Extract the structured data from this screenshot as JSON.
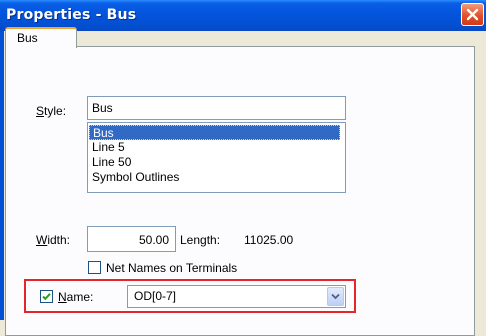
{
  "window": {
    "title": "Properties - Bus"
  },
  "tabs": [
    {
      "label": "Bus"
    }
  ],
  "style_field": {
    "label_ul": "S",
    "label_rest": "tyle:",
    "value": "Bus"
  },
  "style_list": {
    "items": [
      "Bus",
      "Line 5",
      "Line 50",
      "Symbol Outlines"
    ],
    "selected_index": 0
  },
  "width_field": {
    "label_ul": "W",
    "label_rest": "idth:",
    "value": "50.00"
  },
  "length": {
    "label": "Length:",
    "value": "11025.00"
  },
  "net_names_checkbox": {
    "label": "Net Names on Terminals",
    "checked": false
  },
  "name_field": {
    "label_ul": "N",
    "label_rest": "ame:",
    "checked": true,
    "value": "OD[0-7]"
  },
  "colors": {
    "titlebar": "#0454dc",
    "close": "#e0512b",
    "selection": "#316ac5",
    "highlight": "#e4262b"
  },
  "icons": {
    "close": "close-icon",
    "check": "checkmark-icon",
    "dropdown": "chevron-down-icon"
  }
}
